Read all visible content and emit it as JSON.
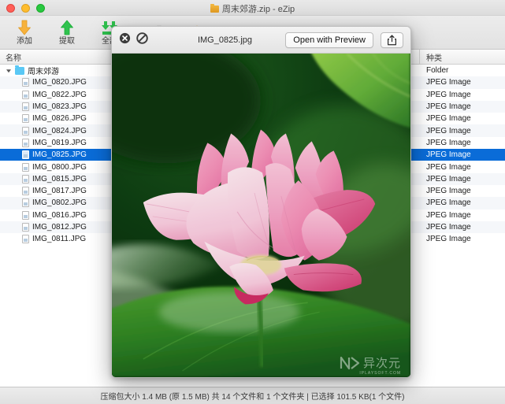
{
  "window": {
    "title": "周末郊游.zip - eZip",
    "traffic_lights": [
      "close",
      "minimize",
      "maximize"
    ]
  },
  "toolbar": {
    "items": [
      {
        "label": "添加",
        "icon": "download-arrow-icon",
        "color": "#f5a623"
      },
      {
        "label": "提取",
        "icon": "upload-arrow-icon",
        "color": "#2bc04a"
      },
      {
        "label": "全部",
        "icon": "extract-all-icon",
        "color": "#2bc04a"
      },
      {
        "label": "",
        "icon": "trash-icon",
        "color": "#8a8a8a"
      },
      {
        "label": "",
        "icon": "lock-icon",
        "color": "#f0a830"
      }
    ]
  },
  "columns": {
    "name": "名称",
    "kind": "种类"
  },
  "files": [
    {
      "name": "周末郊游",
      "kind": "Folder",
      "type": "folder",
      "level": 0,
      "selected": false,
      "expanded": true
    },
    {
      "name": "IMG_0820.JPG",
      "kind": "JPEG Image",
      "type": "jpeg",
      "level": 1,
      "selected": false
    },
    {
      "name": "IMG_0822.JPG",
      "kind": "JPEG Image",
      "type": "jpeg",
      "level": 1,
      "selected": false
    },
    {
      "name": "IMG_0823.JPG",
      "kind": "JPEG Image",
      "type": "jpeg",
      "level": 1,
      "selected": false
    },
    {
      "name": "IMG_0826.JPG",
      "kind": "JPEG Image",
      "type": "jpeg",
      "level": 1,
      "selected": false
    },
    {
      "name": "IMG_0824.JPG",
      "kind": "JPEG Image",
      "type": "jpeg",
      "level": 1,
      "selected": false
    },
    {
      "name": "IMG_0819.JPG",
      "kind": "JPEG Image",
      "type": "jpeg",
      "level": 1,
      "selected": false
    },
    {
      "name": "IMG_0825.JPG",
      "kind": "JPEG Image",
      "type": "jpeg",
      "level": 1,
      "selected": true
    },
    {
      "name": "IMG_0800.JPG",
      "kind": "JPEG Image",
      "type": "jpeg",
      "level": 1,
      "selected": false
    },
    {
      "name": "IMG_0815.JPG",
      "kind": "JPEG Image",
      "type": "jpeg",
      "level": 1,
      "selected": false
    },
    {
      "name": "IMG_0817.JPG",
      "kind": "JPEG Image",
      "type": "jpeg",
      "level": 1,
      "selected": false
    },
    {
      "name": "IMG_0802.JPG",
      "kind": "JPEG Image",
      "type": "jpeg",
      "level": 1,
      "selected": false
    },
    {
      "name": "IMG_0816.JPG",
      "kind": "JPEG Image",
      "type": "jpeg",
      "level": 1,
      "selected": false
    },
    {
      "name": "IMG_0812.JPG",
      "kind": "JPEG Image",
      "type": "jpeg",
      "level": 1,
      "selected": false
    },
    {
      "name": "IMG_0811.JPG",
      "kind": "JPEG Image",
      "type": "jpeg",
      "level": 1,
      "selected": false
    }
  ],
  "statusbar": {
    "text": "压缩包大小 1.4 MB (原 1.5 MB) 共 14 个文件和 1 个文件夹  |  已选择 101.5 KB(1 个文件)"
  },
  "quicklook": {
    "title": "IMG_0825.jpg",
    "close_label": "close-icon",
    "block_label": "no-entry-icon",
    "open_button": "Open with Preview",
    "share_label": "share-icon",
    "image_alt": "pink-lotus-flower",
    "watermark_text": "异次元",
    "watermark_sub": "IPLAYSOFT.COM"
  },
  "colors": {
    "selection": "#0a6cd8",
    "toolbar_add": "#f5a623",
    "toolbar_extract": "#2bc04a",
    "petal_pink": "#f08cb4",
    "leaf_green": "#2f7a23"
  }
}
